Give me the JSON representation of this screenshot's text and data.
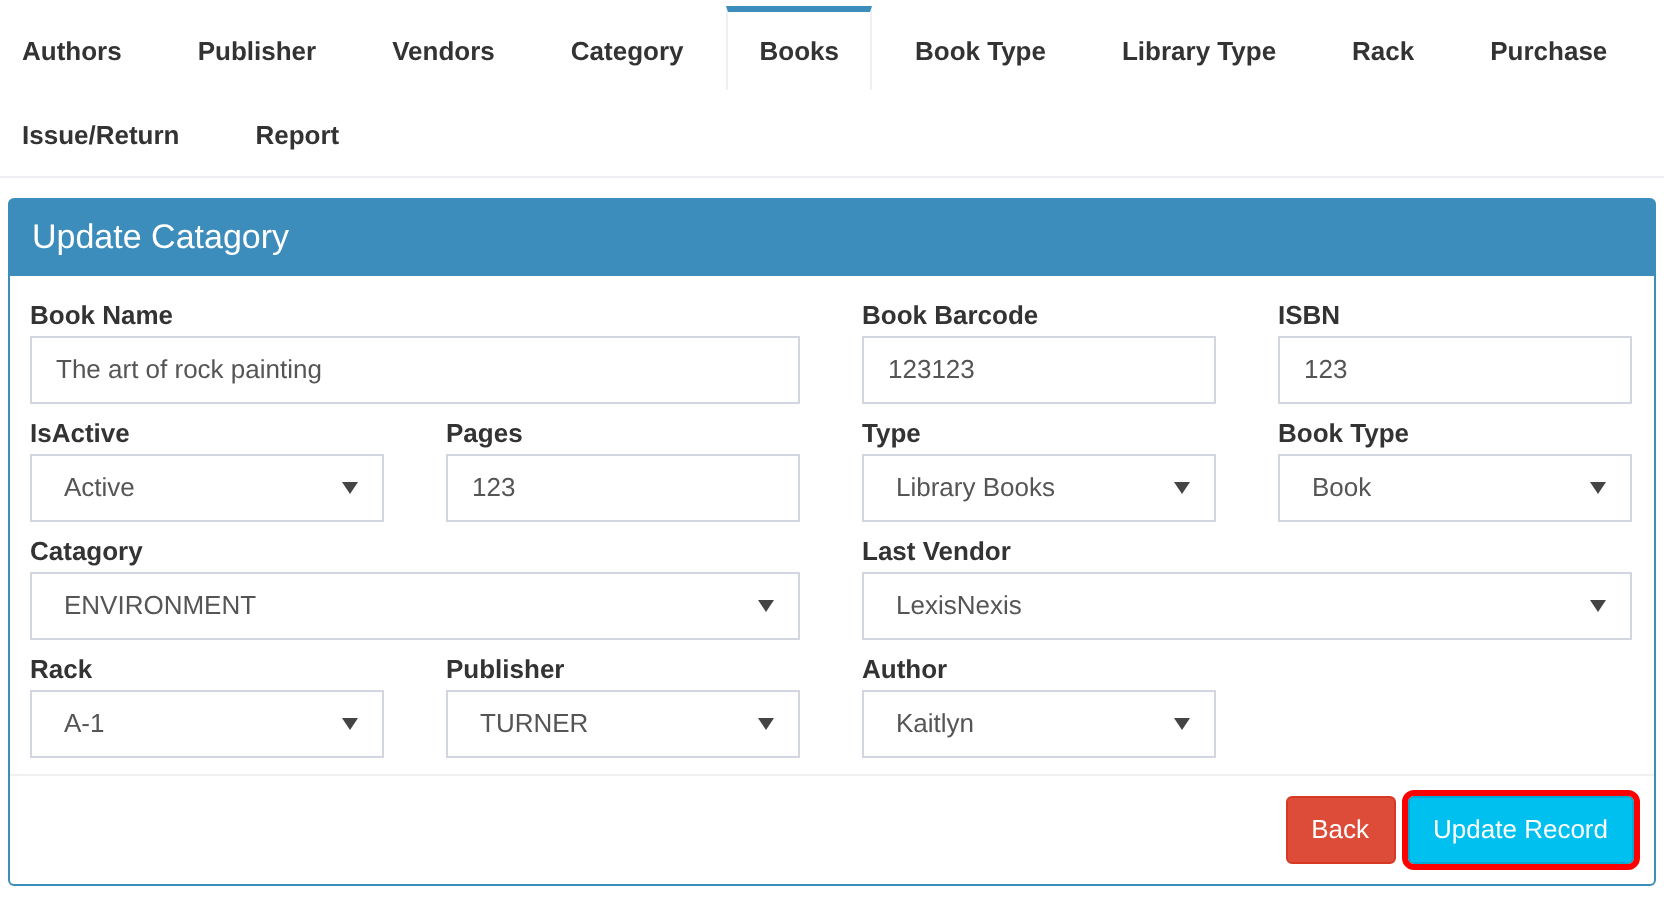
{
  "tabs": [
    {
      "label": "Authors",
      "selected": false
    },
    {
      "label": "Publisher",
      "selected": false
    },
    {
      "label": "Vendors",
      "selected": false
    },
    {
      "label": "Category",
      "selected": false
    },
    {
      "label": "Books",
      "selected": true
    },
    {
      "label": "Book Type",
      "selected": false
    },
    {
      "label": "Library Type",
      "selected": false
    },
    {
      "label": "Rack",
      "selected": false
    },
    {
      "label": "Purchase",
      "selected": false
    },
    {
      "label": "Issue/Return",
      "selected": false
    },
    {
      "label": "Report",
      "selected": false
    }
  ],
  "panel": {
    "title": "Update Catagory",
    "fields": [
      {
        "label": "Book Name",
        "kind": "text",
        "value": "The art of rock painting",
        "wide": true
      },
      {
        "label": "Book Barcode",
        "kind": "text",
        "value": "123123",
        "wide": false
      },
      {
        "label": "ISBN",
        "kind": "text",
        "value": "123",
        "wide": false
      },
      {
        "label": "IsActive",
        "kind": "select",
        "value": "Active",
        "wide": false
      },
      {
        "label": "Pages",
        "kind": "text",
        "value": "123",
        "wide": false
      },
      {
        "label": "Type",
        "kind": "select",
        "value": "Library Books",
        "wide": false
      },
      {
        "label": "Book Type",
        "kind": "select",
        "value": "Book",
        "wide": false
      },
      {
        "label": "Catagory",
        "kind": "select",
        "value": "ENVIRONMENT",
        "wide": true
      },
      {
        "label": "Last Vendor",
        "kind": "select",
        "value": "LexisNexis",
        "wide": true
      },
      {
        "label": "Rack",
        "kind": "select",
        "value": "A-1",
        "wide": false
      },
      {
        "label": "Publisher",
        "kind": "select",
        "value": "TURNER",
        "wide": false
      },
      {
        "label": "Author",
        "kind": "select",
        "value": "Kaitlyn",
        "wide": false
      }
    ],
    "buttons": [
      {
        "label": "Back",
        "kind": "danger",
        "highlighted": false
      },
      {
        "label": "Update Record",
        "kind": "info",
        "highlighted": true
      }
    ]
  }
}
